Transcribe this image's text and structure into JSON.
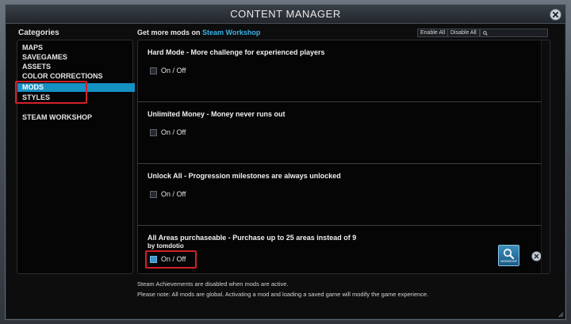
{
  "window": {
    "title": "CONTENT MANAGER"
  },
  "sidebar": {
    "heading": "Categories",
    "items": [
      {
        "label": "MAPS"
      },
      {
        "label": "SAVEGAMES"
      },
      {
        "label": "ASSETS"
      },
      {
        "label": "COLOR CORRECTIONS"
      },
      {
        "label": "MODS",
        "selected": true
      },
      {
        "label": "STYLES"
      },
      {
        "label": "STEAM WORKSHOP"
      }
    ]
  },
  "header": {
    "prefix": "Get more mods on ",
    "link": "Steam Workshop",
    "enable_all": "Enable All",
    "disable_all": "Disable All",
    "search_placeholder": ""
  },
  "mods": [
    {
      "title": "Hard Mode - More challenge for experienced players",
      "subtitle": "",
      "toggle_label": "On / Off",
      "enabled": false
    },
    {
      "title": "Unlimited Money - Money never runs out",
      "subtitle": "",
      "toggle_label": "On / Off",
      "enabled": false
    },
    {
      "title": "Unlock All - Progression milestones are always unlocked",
      "subtitle": "",
      "toggle_label": "On / Off",
      "enabled": false
    },
    {
      "title": "All Areas purchaseable - Purchase up to 25 areas instead of 9",
      "subtitle": "by tomdotio",
      "toggle_label": "On / Off",
      "enabled": true,
      "workshop_badge": "WORKSHOP"
    }
  ],
  "footer": {
    "line1": "Steam Achievements are disabled when mods are active.",
    "line2": "Please note: All mods are global. Activating a mod and loading a saved game will modify the game experience."
  },
  "colors": {
    "accent": "#1591c4",
    "link": "#3ab0e6",
    "highlight": "#d3202a"
  },
  "icons": [
    "close-icon",
    "search-icon",
    "steam-workshop-icon",
    "unsubscribe-icon",
    "resize-grip-icon"
  ]
}
